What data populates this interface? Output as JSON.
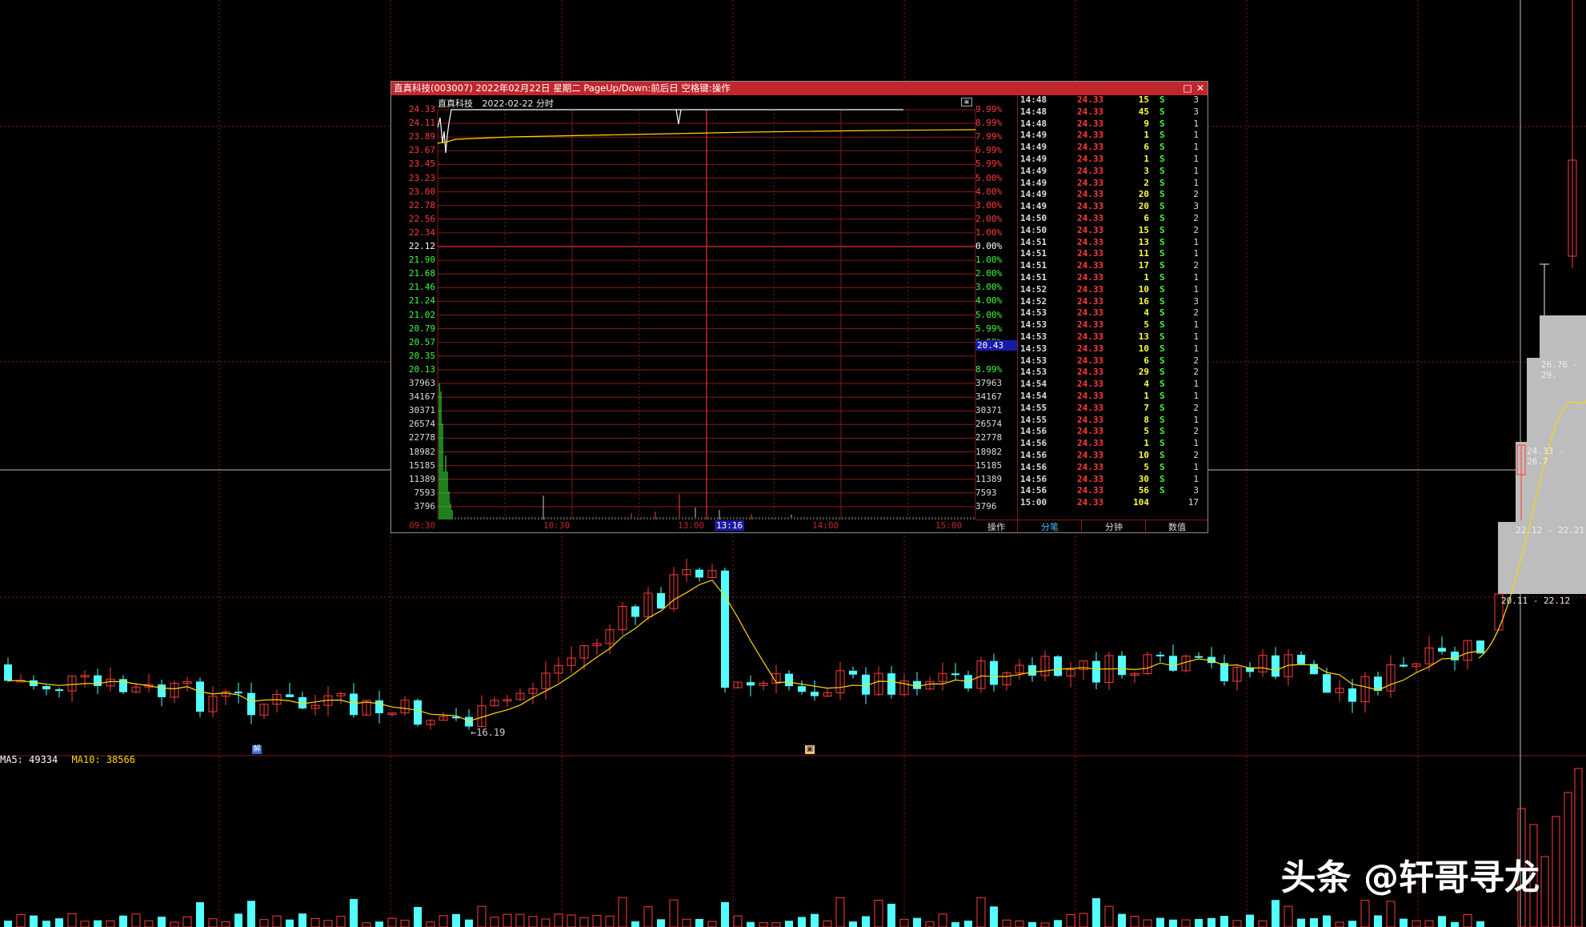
{
  "background": {
    "ma_legend": {
      "ma5_label": "MA5: 49334",
      "ma10_label": "MA10: 38566",
      "ma5_color": "#ffffff",
      "ma10_color": "#ffd700"
    },
    "low_marker": "←16.19",
    "gap_labels": [
      "26.76 - 29.",
      "24.33 - 26.7",
      "22.12 - 22.21",
      "20.11 - 22.12"
    ],
    "tag_icons": [
      "解",
      "▣"
    ],
    "colors": {
      "up": "#ff3c3c",
      "down": "#54ffff",
      "ma_line": "#ffd700",
      "grid": "#8a1a1a"
    }
  },
  "popup": {
    "title": "直真科技(003007) 2022年02月22日 星期二 PageUp/Down:前后日 空格键:操作",
    "maximize_symbol": "□",
    "close_symbol": "✕",
    "chart_name": "直真科技",
    "chart_date": "2022-02-22 分时",
    "expand_symbol": "▣",
    "price_labels": [
      "24.33",
      "24.11",
      "23.89",
      "23.67",
      "23.45",
      "23.23",
      "23.00",
      "22.78",
      "22.56",
      "22.34",
      "22.12",
      "21.90",
      "21.68",
      "21.46",
      "21.24",
      "21.02",
      "20.79",
      "20.57",
      "20.35",
      "20.13"
    ],
    "pct_labels": [
      "9.99%",
      "8.99%",
      "7.99%",
      "6.99%",
      "5.99%",
      "5.00%",
      "4.00%",
      "3.00%",
      "2.00%",
      "1.00%",
      "0.00%",
      "1.00%",
      "2.00%",
      "3.00%",
      "4.00%",
      "5.00%",
      "5.99%",
      "6.99%",
      "7.99%",
      "8.99%"
    ],
    "volume_labels": [
      "37963",
      "34167",
      "30371",
      "26574",
      "22778",
      "18982",
      "15185",
      "11389",
      "7593",
      "3796"
    ],
    "time_labels": [
      "09:30",
      "10:30",
      "13:00",
      "14:00",
      "15:00"
    ],
    "cursor_time": "13:16",
    "cursor_price": "20.43",
    "ticks": [
      {
        "t": "14:48",
        "p": "24.33",
        "v": "15",
        "d": "S",
        "n": "3"
      },
      {
        "t": "14:48",
        "p": "24.33",
        "v": "45",
        "d": "S",
        "n": "3"
      },
      {
        "t": "14:48",
        "p": "24.33",
        "v": "9",
        "d": "S",
        "n": "1"
      },
      {
        "t": "14:49",
        "p": "24.33",
        "v": "1",
        "d": "S",
        "n": "1"
      },
      {
        "t": "14:49",
        "p": "24.33",
        "v": "6",
        "d": "S",
        "n": "1"
      },
      {
        "t": "14:49",
        "p": "24.33",
        "v": "1",
        "d": "S",
        "n": "1"
      },
      {
        "t": "14:49",
        "p": "24.33",
        "v": "3",
        "d": "S",
        "n": "1"
      },
      {
        "t": "14:49",
        "p": "24.33",
        "v": "2",
        "d": "S",
        "n": "1"
      },
      {
        "t": "14:49",
        "p": "24.33",
        "v": "20",
        "d": "S",
        "n": "2"
      },
      {
        "t": "14:49",
        "p": "24.33",
        "v": "20",
        "d": "S",
        "n": "3"
      },
      {
        "t": "14:50",
        "p": "24.33",
        "v": "6",
        "d": "S",
        "n": "2"
      },
      {
        "t": "14:50",
        "p": "24.33",
        "v": "15",
        "d": "S",
        "n": "2"
      },
      {
        "t": "14:51",
        "p": "24.33",
        "v": "13",
        "d": "S",
        "n": "1"
      },
      {
        "t": "14:51",
        "p": "24.33",
        "v": "11",
        "d": "S",
        "n": "1"
      },
      {
        "t": "14:51",
        "p": "24.33",
        "v": "17",
        "d": "S",
        "n": "2"
      },
      {
        "t": "14:51",
        "p": "24.33",
        "v": "1",
        "d": "S",
        "n": "1"
      },
      {
        "t": "14:52",
        "p": "24.33",
        "v": "10",
        "d": "S",
        "n": "1"
      },
      {
        "t": "14:52",
        "p": "24.33",
        "v": "16",
        "d": "S",
        "n": "3"
      },
      {
        "t": "14:53",
        "p": "24.33",
        "v": "4",
        "d": "S",
        "n": "2"
      },
      {
        "t": "14:53",
        "p": "24.33",
        "v": "5",
        "d": "S",
        "n": "1"
      },
      {
        "t": "14:53",
        "p": "24.33",
        "v": "13",
        "d": "S",
        "n": "1"
      },
      {
        "t": "14:53",
        "p": "24.33",
        "v": "10",
        "d": "S",
        "n": "1"
      },
      {
        "t": "14:53",
        "p": "24.33",
        "v": "6",
        "d": "S",
        "n": "2"
      },
      {
        "t": "14:53",
        "p": "24.33",
        "v": "29",
        "d": "S",
        "n": "2"
      },
      {
        "t": "14:54",
        "p": "24.33",
        "v": "4",
        "d": "S",
        "n": "1"
      },
      {
        "t": "14:54",
        "p": "24.33",
        "v": "1",
        "d": "S",
        "n": "1"
      },
      {
        "t": "14:55",
        "p": "24.33",
        "v": "7",
        "d": "S",
        "n": "2"
      },
      {
        "t": "14:55",
        "p": "24.33",
        "v": "8",
        "d": "S",
        "n": "1"
      },
      {
        "t": "14:56",
        "p": "24.33",
        "v": "5",
        "d": "S",
        "n": "2"
      },
      {
        "t": "14:56",
        "p": "24.33",
        "v": "1",
        "d": "S",
        "n": "1"
      },
      {
        "t": "14:56",
        "p": "24.33",
        "v": "10",
        "d": "S",
        "n": "2"
      },
      {
        "t": "14:56",
        "p": "24.33",
        "v": "5",
        "d": "S",
        "n": "1"
      },
      {
        "t": "14:56",
        "p": "24.33",
        "v": "30",
        "d": "S",
        "n": "1"
      },
      {
        "t": "14:56",
        "p": "24.33",
        "v": "56",
        "d": "S",
        "n": "3"
      },
      {
        "t": "15:00",
        "p": "24.33",
        "v": "104",
        "d": "",
        "n": "17"
      }
    ],
    "tabs": [
      "操作",
      "分笔",
      "分钟",
      "数值"
    ]
  },
  "watermark": "头条 @轩哥寻龙"
}
